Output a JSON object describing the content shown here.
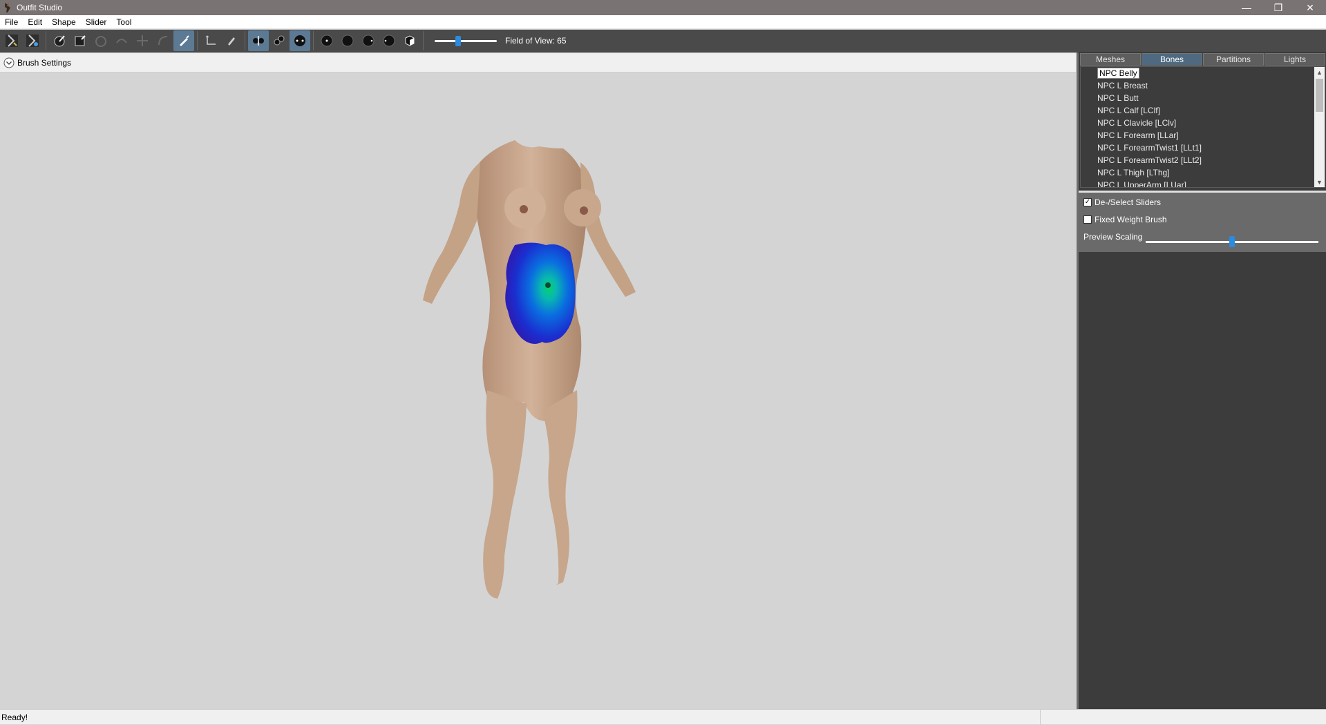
{
  "app": {
    "title": "Outfit Studio",
    "window_controls": {
      "minimize": "—",
      "restore": "❐",
      "close": "✕"
    }
  },
  "menu": [
    "File",
    "Edit",
    "Shape",
    "Slider",
    "Tool"
  ],
  "toolbar": {
    "buttons": [
      {
        "name": "select-tool-icon",
        "active": false
      },
      {
        "name": "transform-tool-icon",
        "active": false
      },
      {
        "name": "brush-inflate-icon",
        "active": false
      },
      {
        "name": "brush-mask-icon",
        "active": false
      },
      {
        "name": "brush-deflate-icon",
        "active": false
      },
      {
        "name": "brush-smooth-icon",
        "active": false
      },
      {
        "name": "brush-move-icon",
        "active": false
      },
      {
        "name": "brush-undiff-icon",
        "active": false
      },
      {
        "name": "brush-weight-icon",
        "active": true
      },
      {
        "name": "pivot-tool-icon",
        "active": false
      },
      {
        "name": "brush-color-icon",
        "active": false
      },
      {
        "name": "x-mirror-icon",
        "active": true
      },
      {
        "name": "connected-only-icon",
        "active": true
      },
      {
        "name": "global-brush-icon",
        "active": true
      },
      {
        "name": "view-front-icon",
        "active": false
      },
      {
        "name": "view-back-icon",
        "active": false
      },
      {
        "name": "view-left-icon",
        "active": false
      },
      {
        "name": "view-right-icon",
        "active": false
      },
      {
        "name": "perspective-icon",
        "active": false
      }
    ],
    "fov_slider_value": 0.37,
    "fov_label": "Field of View: 65"
  },
  "brush_settings": {
    "label": "Brush Settings"
  },
  "right_pane": {
    "tabs": [
      {
        "label": "Meshes",
        "active": false
      },
      {
        "label": "Bones",
        "active": true
      },
      {
        "label": "Partitions",
        "active": false
      },
      {
        "label": "Lights",
        "active": false
      }
    ],
    "bones": [
      {
        "label": "NPC Belly",
        "selected": true
      },
      {
        "label": "NPC L Breast",
        "selected": false
      },
      {
        "label": "NPC L Butt",
        "selected": false
      },
      {
        "label": "NPC L Calf [LClf]",
        "selected": false
      },
      {
        "label": "NPC L Clavicle [LClv]",
        "selected": false
      },
      {
        "label": "NPC L Forearm [LLar]",
        "selected": false
      },
      {
        "label": "NPC L ForearmTwist1 [LLt1]",
        "selected": false
      },
      {
        "label": "NPC L ForearmTwist2 [LLt2]",
        "selected": false
      },
      {
        "label": "NPC L Thigh [LThg]",
        "selected": false
      },
      {
        "label": "NPC L UpperArm [LUar]",
        "selected": false
      }
    ],
    "options": {
      "deselect_sliders": {
        "label": "De-/Select Sliders",
        "checked": true
      },
      "fixed_weight_brush": {
        "label": "Fixed Weight Brush",
        "checked": false
      },
      "preview_scaling": {
        "label": "Preview Scaling",
        "value": 0.5
      }
    }
  },
  "status": {
    "text": "Ready!"
  },
  "colors": {
    "title_bar": "#7a7373",
    "toolbar": "#4a4a4a",
    "viewport": "#d4d4d4",
    "panel": "#3c3c3c",
    "accent": "#2a8be0",
    "skin": "#c9a68a",
    "weight_paint": "#1a2fd0"
  }
}
